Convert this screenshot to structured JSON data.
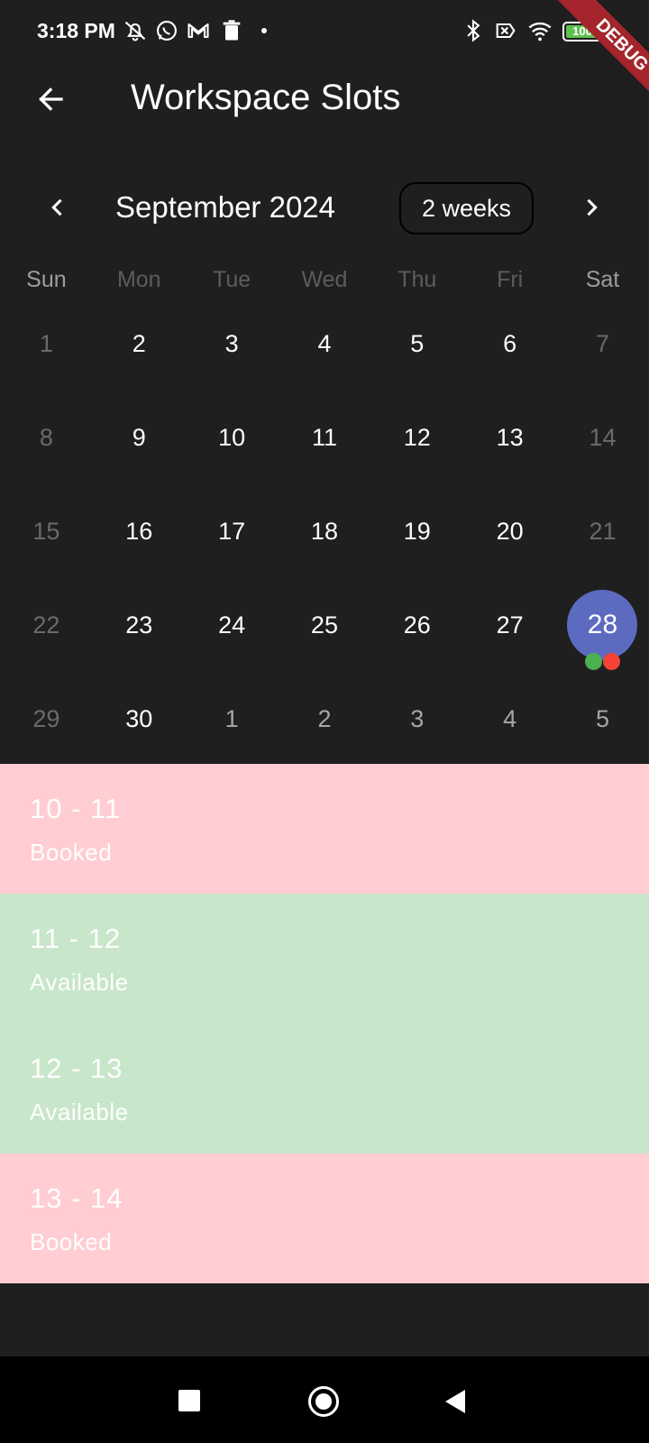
{
  "status_bar": {
    "time": "3:18 PM",
    "left_icons": [
      "notifications-off-icon",
      "whatsapp-icon",
      "gmail-icon",
      "trash-icon"
    ],
    "right_icons": [
      "bluetooth-icon",
      "no-sim-icon",
      "wifi-icon",
      "battery-icon"
    ],
    "battery": "100",
    "battery_level": 1.0
  },
  "debug_banner": "DEBUG",
  "app_bar": {
    "title": "Workspace Slots",
    "back_icon": "arrow-back-icon"
  },
  "calendar": {
    "month_title": "September 2024",
    "format_button": "2 weeks",
    "prev_icon": "chevron-left-icon",
    "next_icon": "chevron-right-icon",
    "weekdays": [
      "Sun",
      "Mon",
      "Tue",
      "Wed",
      "Thu",
      "Fri",
      "Sat"
    ],
    "weeks": [
      [
        {
          "d": "1",
          "s": "weekend"
        },
        {
          "d": "2",
          "s": "active"
        },
        {
          "d": "3",
          "s": "active"
        },
        {
          "d": "4",
          "s": "active"
        },
        {
          "d": "5",
          "s": "active"
        },
        {
          "d": "6",
          "s": "active"
        },
        {
          "d": "7",
          "s": "weekend"
        }
      ],
      [
        {
          "d": "8",
          "s": "weekend"
        },
        {
          "d": "9",
          "s": "active"
        },
        {
          "d": "10",
          "s": "active"
        },
        {
          "d": "11",
          "s": "active"
        },
        {
          "d": "12",
          "s": "active"
        },
        {
          "d": "13",
          "s": "active"
        },
        {
          "d": "14",
          "s": "weekend"
        }
      ],
      [
        {
          "d": "15",
          "s": "weekend"
        },
        {
          "d": "16",
          "s": "active"
        },
        {
          "d": "17",
          "s": "active"
        },
        {
          "d": "18",
          "s": "active"
        },
        {
          "d": "19",
          "s": "active"
        },
        {
          "d": "20",
          "s": "active"
        },
        {
          "d": "21",
          "s": "weekend"
        }
      ],
      [
        {
          "d": "22",
          "s": "weekend"
        },
        {
          "d": "23",
          "s": "active"
        },
        {
          "d": "24",
          "s": "active"
        },
        {
          "d": "25",
          "s": "active"
        },
        {
          "d": "26",
          "s": "active"
        },
        {
          "d": "27",
          "s": "active"
        },
        {
          "d": "28",
          "s": "selected",
          "markers": [
            "#4caf50",
            "#f44336"
          ]
        }
      ],
      [
        {
          "d": "29",
          "s": "weekend"
        },
        {
          "d": "30",
          "s": "active"
        },
        {
          "d": "1",
          "s": "outside"
        },
        {
          "d": "2",
          "s": "outside"
        },
        {
          "d": "3",
          "s": "outside"
        },
        {
          "d": "4",
          "s": "outside"
        },
        {
          "d": "5",
          "s": "outside"
        }
      ]
    ],
    "selected_color": "#5c6bc0"
  },
  "slots": [
    {
      "time": "10 - 11",
      "status": "Booked",
      "color": "#ffcdd2"
    },
    {
      "time": "11 - 12",
      "status": "Available",
      "color": "#c8e6c9"
    },
    {
      "time": "12 - 13",
      "status": "Available",
      "color": "#c8e6c9"
    },
    {
      "time": "13 - 14",
      "status": "Booked",
      "color": "#ffcdd2"
    }
  ],
  "nav_bar": {
    "icons": [
      "recents-square-icon",
      "home-circle-icon",
      "back-triangle-icon"
    ]
  }
}
